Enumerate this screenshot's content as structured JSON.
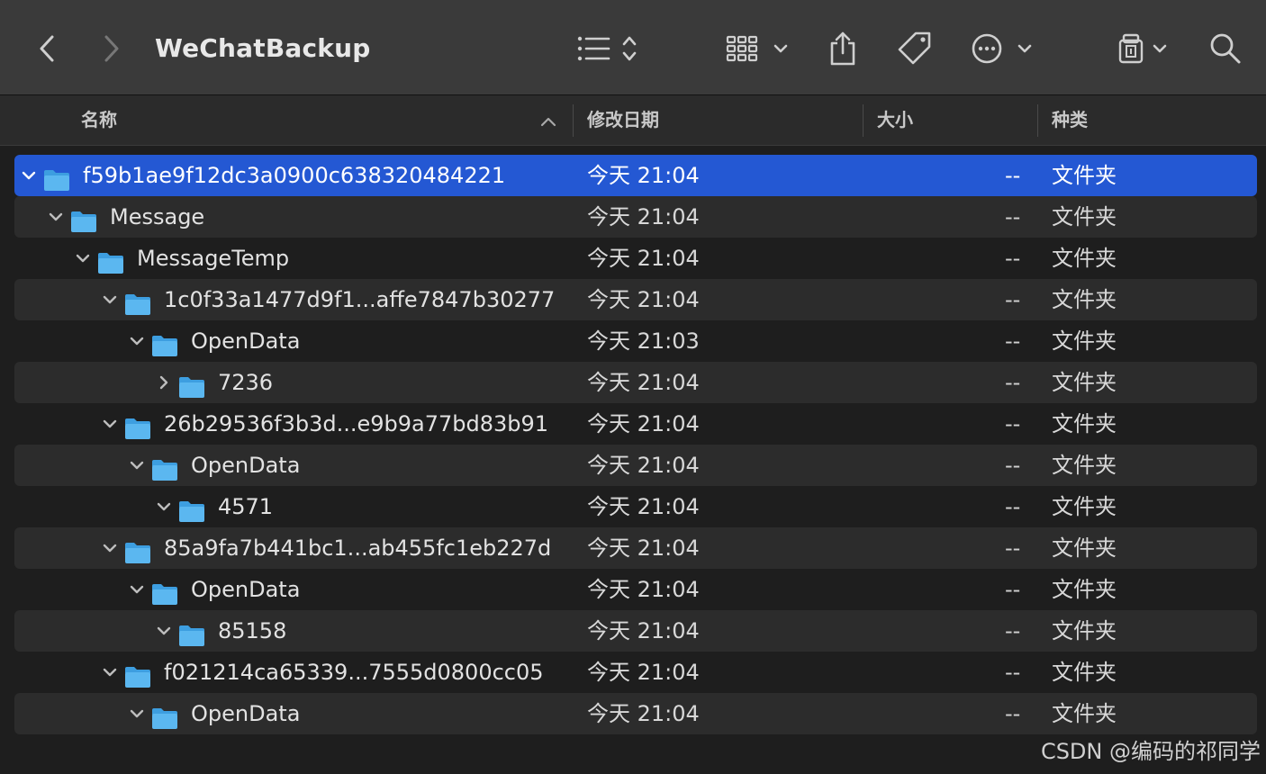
{
  "window": {
    "title": "WeChatBackup"
  },
  "toolbar": {
    "icons": [
      "chevron-left-icon",
      "chevron-right-icon",
      "list-view-icon",
      "grid-view-icon",
      "share-icon",
      "tag-icon",
      "more-icon",
      "drive-icon",
      "search-icon"
    ]
  },
  "columns": {
    "name": "名称",
    "date": "修改日期",
    "size": "大小",
    "kind": "种类"
  },
  "rows": [
    {
      "name": "f59b1ae9f12dc3a0900c638320484221",
      "depth": 0,
      "expanded": true,
      "date": "今天 21:04",
      "size": "--",
      "kind": "文件夹",
      "selected": true
    },
    {
      "name": "Message",
      "depth": 1,
      "expanded": true,
      "date": "今天 21:04",
      "size": "--",
      "kind": "文件夹"
    },
    {
      "name": "MessageTemp",
      "depth": 2,
      "expanded": true,
      "date": "今天 21:04",
      "size": "--",
      "kind": "文件夹"
    },
    {
      "name": "1c0f33a1477d9f1...affe7847b30277",
      "depth": 3,
      "expanded": true,
      "date": "今天 21:04",
      "size": "--",
      "kind": "文件夹"
    },
    {
      "name": "OpenData",
      "depth": 4,
      "expanded": true,
      "date": "今天 21:03",
      "size": "--",
      "kind": "文件夹"
    },
    {
      "name": "7236",
      "depth": 5,
      "expanded": false,
      "date": "今天 21:04",
      "size": "--",
      "kind": "文件夹"
    },
    {
      "name": "26b29536f3b3d...e9b9a77bd83b91",
      "depth": 3,
      "expanded": true,
      "date": "今天 21:04",
      "size": "--",
      "kind": "文件夹"
    },
    {
      "name": "OpenData",
      "depth": 4,
      "expanded": true,
      "date": "今天 21:04",
      "size": "--",
      "kind": "文件夹"
    },
    {
      "name": "4571",
      "depth": 5,
      "expanded": true,
      "date": "今天 21:04",
      "size": "--",
      "kind": "文件夹"
    },
    {
      "name": "85a9fa7b441bc1...ab455fc1eb227d",
      "depth": 3,
      "expanded": true,
      "date": "今天 21:04",
      "size": "--",
      "kind": "文件夹"
    },
    {
      "name": "OpenData",
      "depth": 4,
      "expanded": true,
      "date": "今天 21:04",
      "size": "--",
      "kind": "文件夹"
    },
    {
      "name": "85158",
      "depth": 5,
      "expanded": true,
      "date": "今天 21:04",
      "size": "--",
      "kind": "文件夹"
    },
    {
      "name": "f021214ca65339...7555d0800cc05",
      "depth": 3,
      "expanded": true,
      "date": "今天 21:04",
      "size": "--",
      "kind": "文件夹"
    },
    {
      "name": "OpenData",
      "depth": 4,
      "expanded": true,
      "date": "今天 21:04",
      "size": "--",
      "kind": "文件夹"
    }
  ],
  "colors": {
    "selection": "#2458d3",
    "folder": "#5bb7f0",
    "folder_tab": "#3d9ee0"
  },
  "watermark": "CSDN @编码的祁同学"
}
